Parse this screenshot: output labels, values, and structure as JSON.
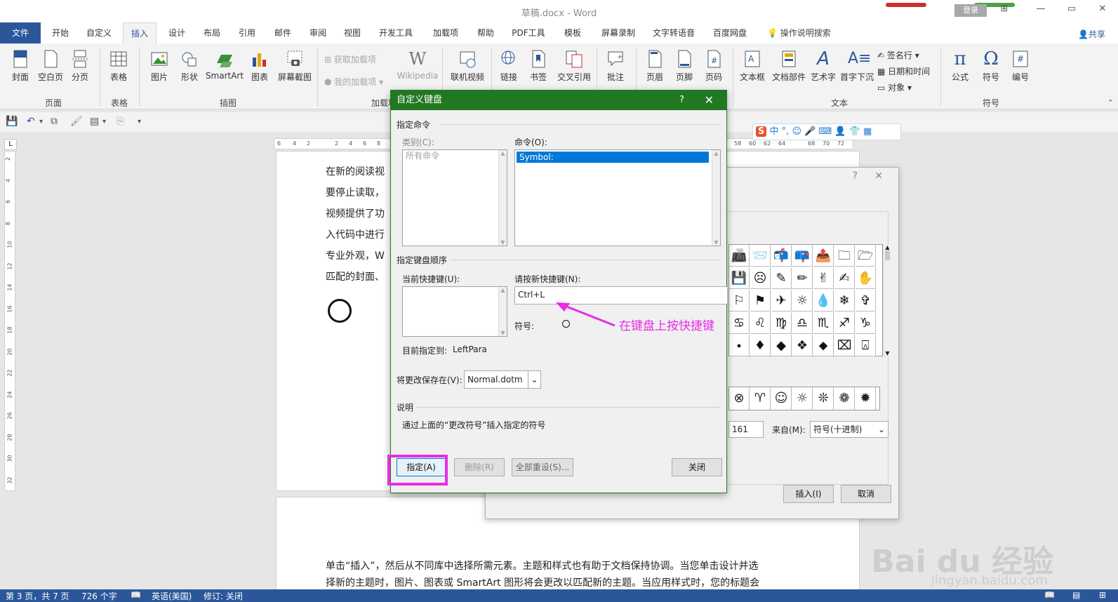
{
  "titlebar": {
    "doc_title": "草稿.docx  -  Word",
    "login": "登录"
  },
  "tabs": [
    "文件",
    "开始",
    "自定义",
    "插入",
    "设计",
    "布局",
    "引用",
    "邮件",
    "审阅",
    "视图",
    "开发工具",
    "加载项",
    "帮助",
    "PDF工具",
    "模板",
    "屏幕录制",
    "文字转语音",
    "百度网盘"
  ],
  "active_tab": "插入",
  "search_tab": "操作说明搜索",
  "share": "共享",
  "ribbon": {
    "buttons": [
      "封面",
      "空白页",
      "分页",
      "表格",
      "图片",
      "形状",
      "SmartArt",
      "图表",
      "屏幕截图",
      "Wikipedia",
      "联机视频",
      "链接",
      "书签",
      "交叉引用",
      "批注",
      "页眉",
      "页脚",
      "页码",
      "文本框",
      "文档部件",
      "艺术字",
      "首字下沉",
      "公式",
      "符号",
      "编号"
    ],
    "small": [
      "获取加载项",
      "我的加载项",
      "签名行",
      "日期和时间",
      "对象"
    ],
    "groups": [
      "页面",
      "表格",
      "插图",
      "加载项",
      "文本",
      "符号"
    ]
  },
  "ruler_h": [
    "6",
    "4",
    "2",
    "2",
    "4",
    "6",
    "8",
    "58",
    "60",
    "62",
    "64",
    "68",
    "70",
    "72"
  ],
  "ruler_v": [
    "2",
    "4",
    "6",
    "8",
    "10",
    "12",
    "14",
    "16",
    "18",
    "20",
    "22",
    "24",
    "26",
    "28",
    "30",
    "32"
  ],
  "document": {
    "lines": [
      "在新的阅读视",
      "要停止读取，",
      "视频提供了功",
      "入代码中进行",
      "专业外观，W",
      "匹配的封面、"
    ],
    "page2_line1": "单击“插入”，然后从不同库中选择所需元素。主题和样式也有助于文档保持协调。当您单击设计并选",
    "page2_line2": "择新的主题时，图片、图表或 SmartArt 图形将会更改以匹配新的主题。当应用样式时，您的标题会"
  },
  "symbol_dialog": {
    "q": "?",
    "close": "✕",
    "grid": [
      "📠",
      "📨",
      "📬",
      "📪",
      "📤",
      "🗀",
      "🗁",
      "💾",
      "☹",
      "✎",
      "✏",
      "✌",
      "✍",
      "✋",
      "⚐",
      "⚑",
      "✈",
      "☼",
      "💧",
      "❄",
      "✞",
      "♋",
      "♌",
      "♍",
      "♎",
      "♏",
      "♐",
      "♑",
      "⬩",
      "♦",
      "◆",
      "❖",
      "⬥",
      "⌧",
      "⍓"
    ],
    "recent": [
      "⊗",
      "♈",
      "☺",
      "☼",
      "❊",
      "❁",
      "✹"
    ],
    "char_code": "161",
    "from_label": "来自(M):",
    "from_value": "符号(十进制)",
    "insert": "插入(I)",
    "cancel": "取消"
  },
  "kbd_dialog": {
    "title": "自定义键盘",
    "q": "?",
    "close": "✕",
    "section_command": "指定命令",
    "category_label": "类别(C):",
    "category_item": "所有命令",
    "command_label": "命令(O):",
    "command_item": "Symbol:",
    "section_keys": "指定键盘顺序",
    "current_keys_label": "当前快捷键(U):",
    "new_key_label": "请按新快捷键(N):",
    "new_key_value": "Ctrl+L",
    "symbol_label": "符号:",
    "assigned_to_label": "目前指定到:",
    "assigned_to_value": "LeftPara",
    "save_in_label": "将更改保存在(V):",
    "save_in_value": "Normal.dotm",
    "section_desc": "说明",
    "desc_text": "通过上面的“更改符号”插入指定的符号",
    "assign": "指定(A)",
    "remove": "删除(R)",
    "reset_all": "全部重设(S)...",
    "close_btn": "关闭"
  },
  "annotation": "在键盘上按快捷键",
  "status": {
    "page": "第 3 页，共 7 页",
    "words": "726 个字",
    "lang": "英语(美国)",
    "track": "修订: 关闭"
  },
  "watermark": {
    "main": "Bai du 经验",
    "sub": "jingyan.baidu.com"
  },
  "colors": {
    "word_blue": "#2b579a",
    "dialog_green": "#217821",
    "annotation_magenta": "#e62de6",
    "selection_blue": "#0078d7"
  }
}
